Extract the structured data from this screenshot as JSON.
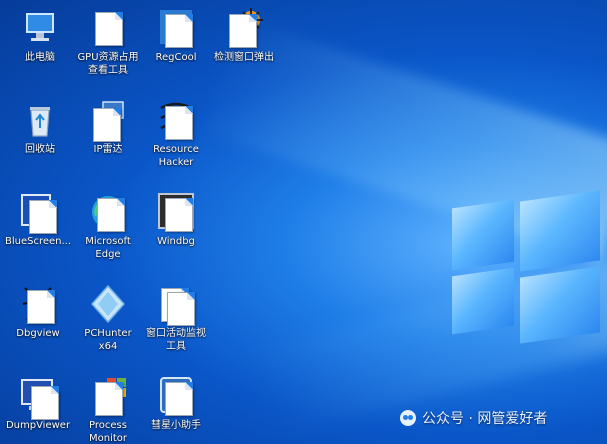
{
  "desktop": {
    "icons": [
      {
        "label": "此电脑",
        "icon": "this-pc-icon"
      },
      {
        "label": "GPU资源占用\n查看工具",
        "icon": "gpu-tool-icon"
      },
      {
        "label": "RegCool",
        "icon": "regcool-icon"
      },
      {
        "label": "检测窗口弹出",
        "icon": "popup-detector-icon"
      },
      {
        "label": "回收站",
        "icon": "recycle-bin-icon"
      },
      {
        "label": "IP雷达",
        "icon": "ip-radar-icon"
      },
      {
        "label": "Resource\nHacker",
        "icon": "resource-hacker-icon"
      },
      {
        "label": "BlueScreen...",
        "icon": "bluescreen-view-icon"
      },
      {
        "label": "Microsoft\nEdge",
        "icon": "edge-icon"
      },
      {
        "label": "Windbg",
        "icon": "windbg-icon"
      },
      {
        "label": "Dbgview",
        "icon": "dbgview-icon"
      },
      {
        "label": "PCHunter\nx64",
        "icon": "pchunter-icon"
      },
      {
        "label": "窗口活动监视\n工具",
        "icon": "window-monitor-icon"
      },
      {
        "label": "DumpViewer",
        "icon": "dumpviewer-icon"
      },
      {
        "label": "Process\nMonitor",
        "icon": "process-monitor-icon"
      },
      {
        "label": "彗星小助手",
        "icon": "comet-helper-icon"
      }
    ]
  },
  "watermark": {
    "text": "公众号 · 网管爱好者"
  },
  "colors": {
    "accent": "#1f7ee8",
    "wallpaper_dark": "#063c9a",
    "wallpaper_light": "#5fb3ff"
  }
}
